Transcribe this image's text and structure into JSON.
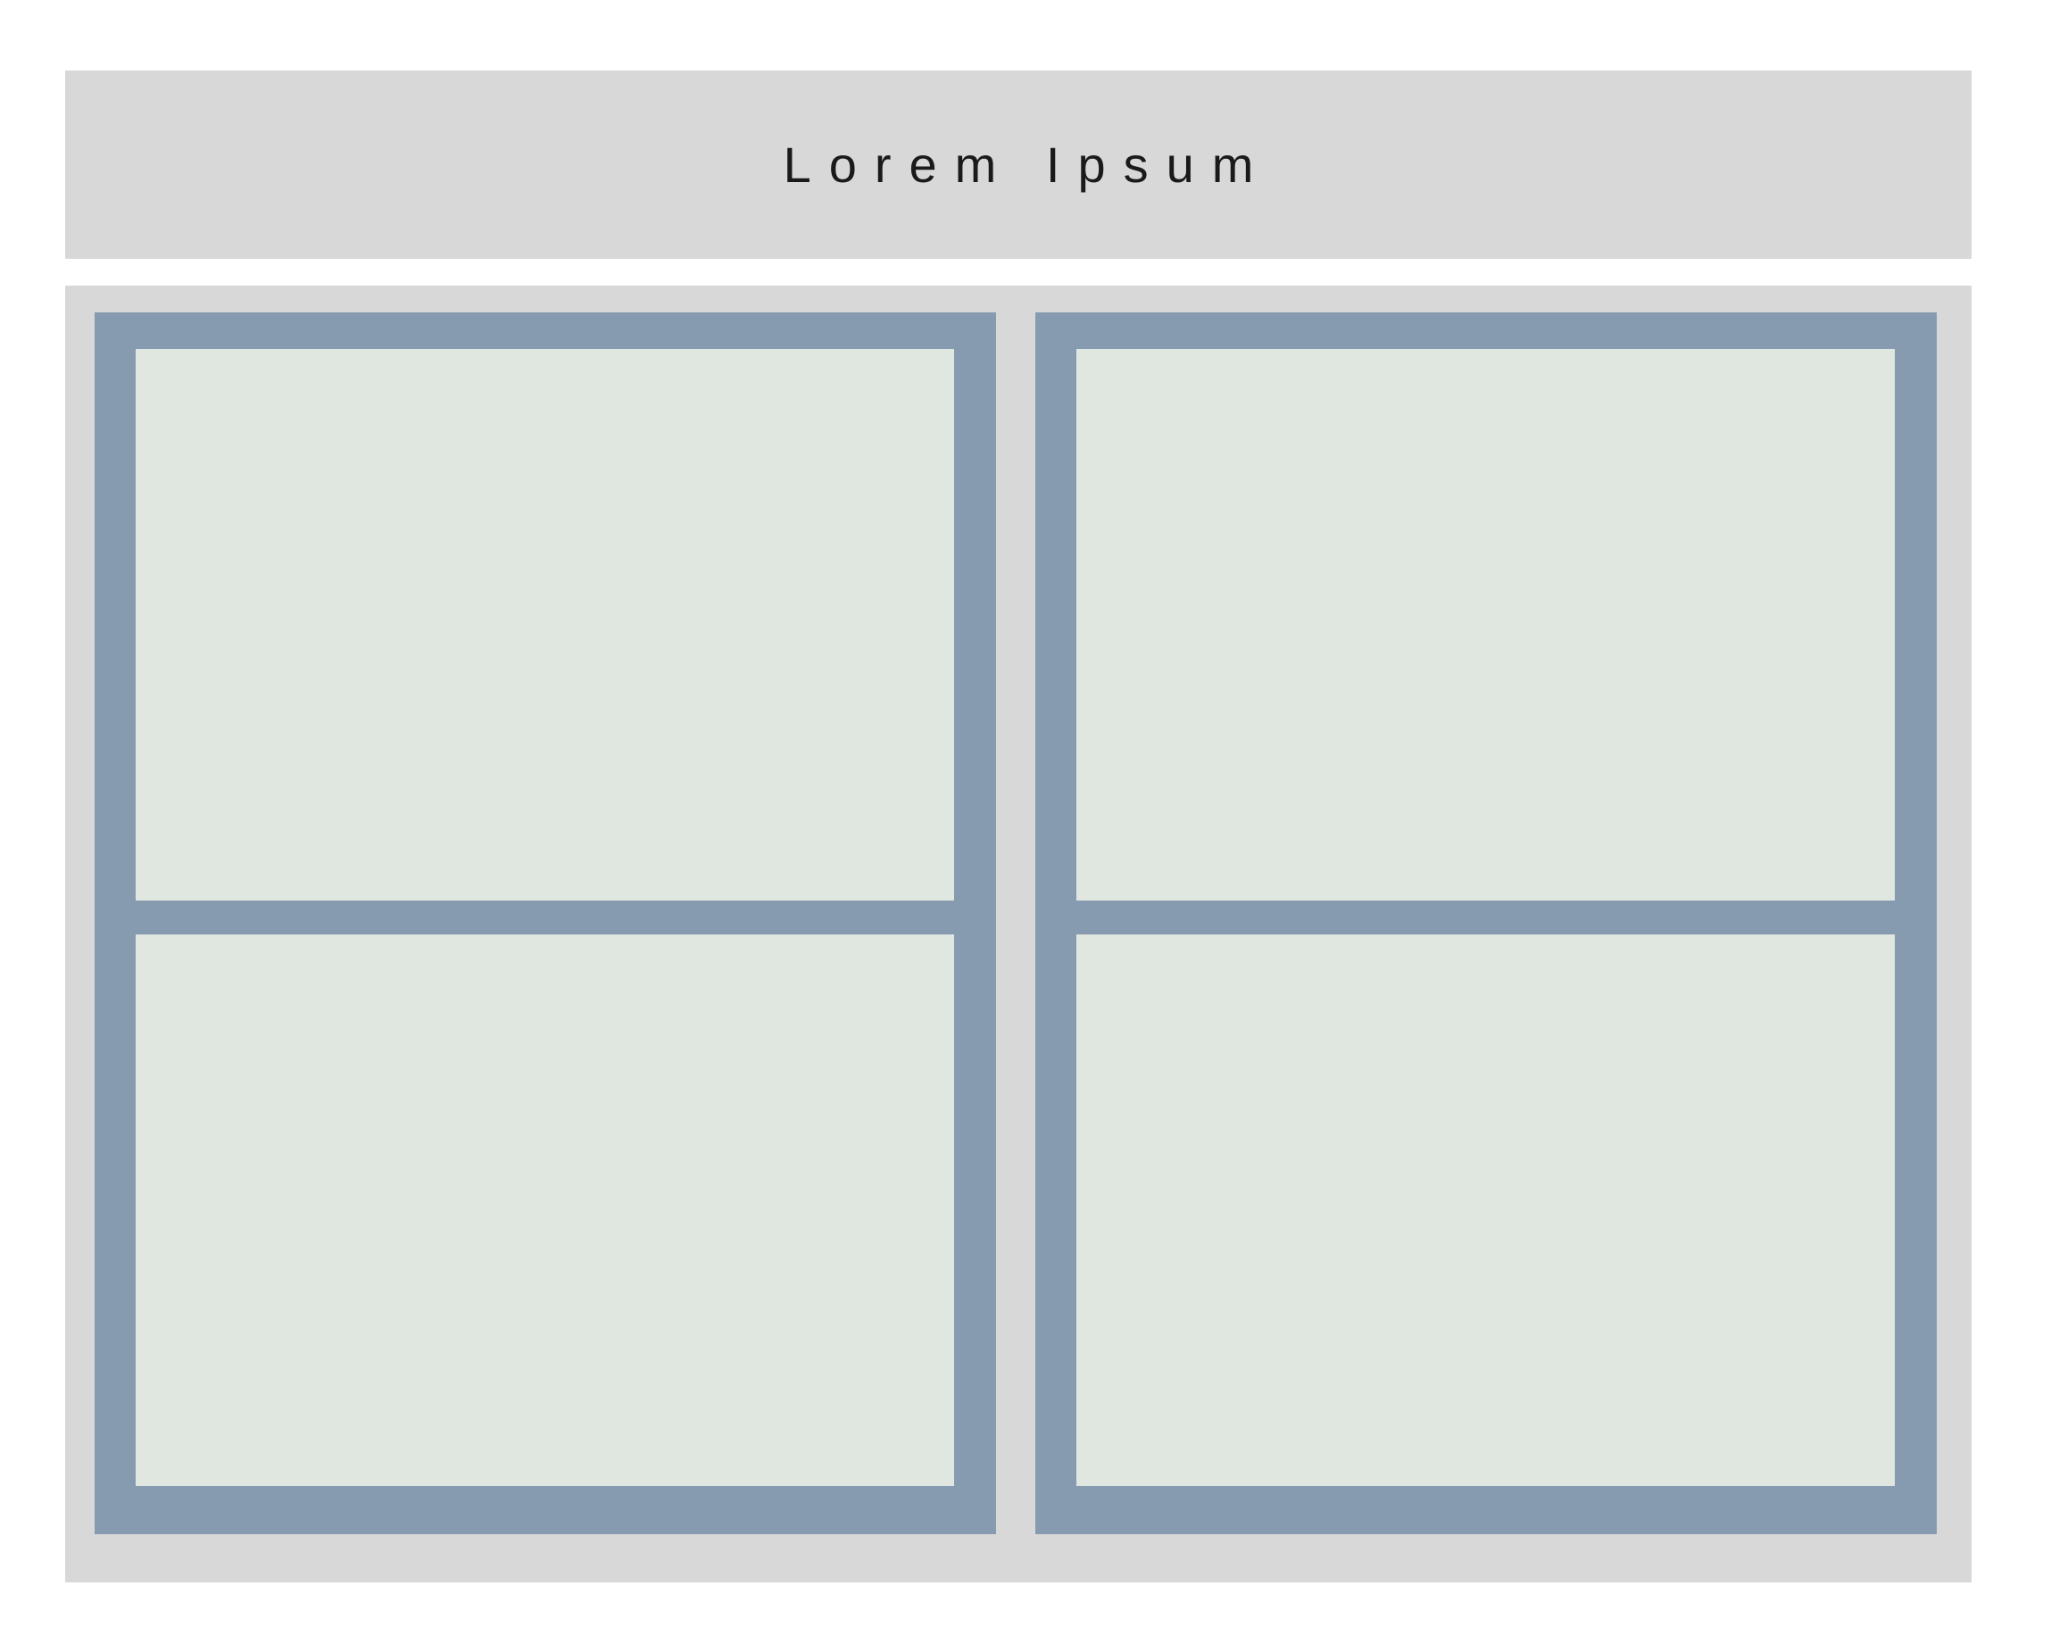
{
  "header": {
    "title": "Lorem Ipsum"
  },
  "colors": {
    "background": "#ffffff",
    "panel": "#d8d8d8",
    "frame": "#879bb0",
    "cell": "#e0e7e1",
    "text": "#1a1a1a"
  }
}
